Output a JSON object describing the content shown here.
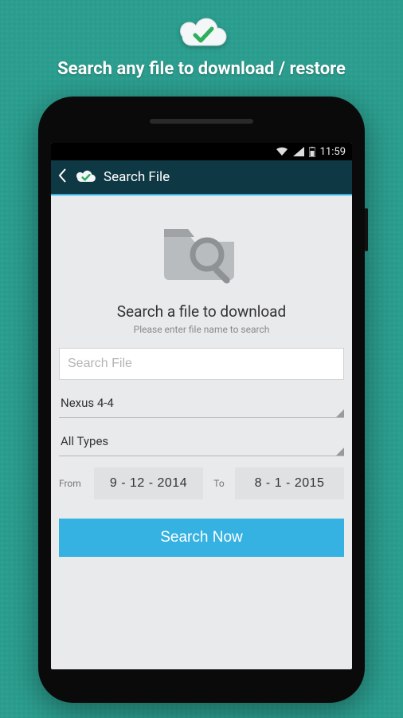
{
  "promo": {
    "title": "Search any file to download / restore"
  },
  "statusbar": {
    "time": "11:59"
  },
  "actionbar": {
    "title": "Search File"
  },
  "hero": {
    "title": "Search a file to download",
    "subtitle": "Please enter file name to search"
  },
  "search": {
    "placeholder": "Search File",
    "value": ""
  },
  "device_spinner": {
    "value": "Nexus 4-4"
  },
  "type_spinner": {
    "value": "All Types"
  },
  "date": {
    "from_label": "From",
    "from_value": "9 - 12 - 2014",
    "to_label": "To",
    "to_value": "8 - 1 - 2015"
  },
  "buttons": {
    "search_now": "Search Now"
  },
  "colors": {
    "accent": "#35b2e2",
    "actionbar": "#0f3845",
    "background": "#2b9e8f"
  }
}
